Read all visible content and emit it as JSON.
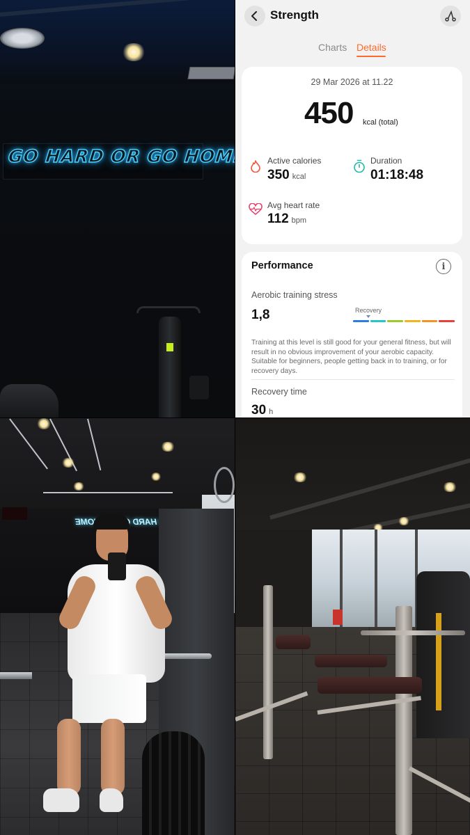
{
  "photo_top_left": {
    "neon_sign": "GO HARD OR GO HOME"
  },
  "app": {
    "header": {
      "title": "Strength",
      "back_icon": "chevron-left-icon",
      "route_icon": "route-icon"
    },
    "tabs": [
      {
        "label": "Charts",
        "active": false
      },
      {
        "label": "Details",
        "active": true
      }
    ],
    "accent_color": "#ff6a2b",
    "summary": {
      "datetime": "29 Mar 2026 at 11.22",
      "total_value": "450",
      "total_unit": "kcal (total)",
      "active_calories": {
        "label": "Active calories",
        "value": "350",
        "unit": "kcal",
        "icon": "flame-icon"
      },
      "duration": {
        "label": "Duration",
        "value": "01:18:48",
        "icon": "stopwatch-icon"
      },
      "avg_heart_rate": {
        "label": "Avg heart rate",
        "value": "112",
        "unit": "bpm",
        "icon": "heartbeat-icon"
      }
    },
    "performance": {
      "title": "Performance",
      "info_icon": "info-icon",
      "aerobic_training_stress": {
        "label": "Aerobic training stress",
        "value": "1,8",
        "scale_label": "Recovery",
        "scale_colors": [
          "#2a7de1",
          "#27c6c6",
          "#9ccc2b",
          "#f2b51e",
          "#f39425",
          "#e8413b"
        ]
      },
      "description": "Training at this level is still good for your general fitness, but will result in no obvious improvement of your aerobic capacity. Suitable for beginners, people getting back in to training, or for recovery days.",
      "recovery_time": {
        "label": "Recovery time",
        "value": "30",
        "unit": "h"
      }
    }
  },
  "photo_bottom_left": {
    "mirrored_neon": "GO HARD OR GO HOME"
  }
}
